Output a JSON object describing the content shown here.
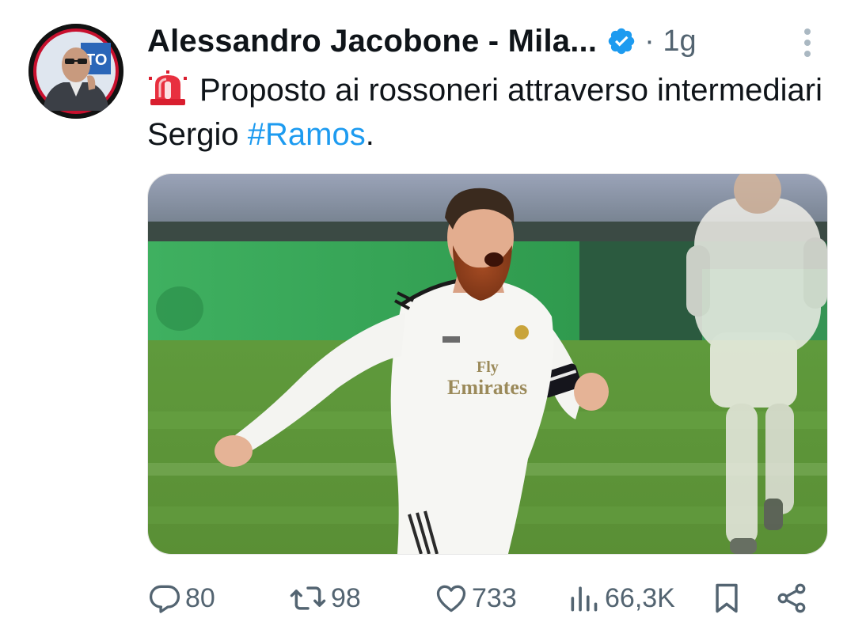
{
  "tweet": {
    "author_name": "Alessandro Jacobone - Mila...",
    "meta": "· 1g",
    "emoji": "🚨",
    "text_before": "Proposto ai rossoneri attraverso intermediari Sergio ",
    "hashtag": "#Ramos",
    "text_after": ".",
    "hashtag_color": "#1d9bf0",
    "verified_color": "#1d9bf0"
  },
  "media": {
    "jersey_text_line1": "Fly",
    "jersey_text_line2": "Emirates"
  },
  "actions": {
    "replies": "80",
    "retweets": "98",
    "likes": "733",
    "views": "66,3K"
  },
  "icons": {
    "reply": "reply-icon",
    "retweet": "retweet-icon",
    "like": "heart-icon",
    "views": "views-chart-icon",
    "bookmark": "bookmark-icon",
    "share": "share-icon",
    "more": "more-vertical-icon",
    "verified": "verified-badge-icon"
  }
}
